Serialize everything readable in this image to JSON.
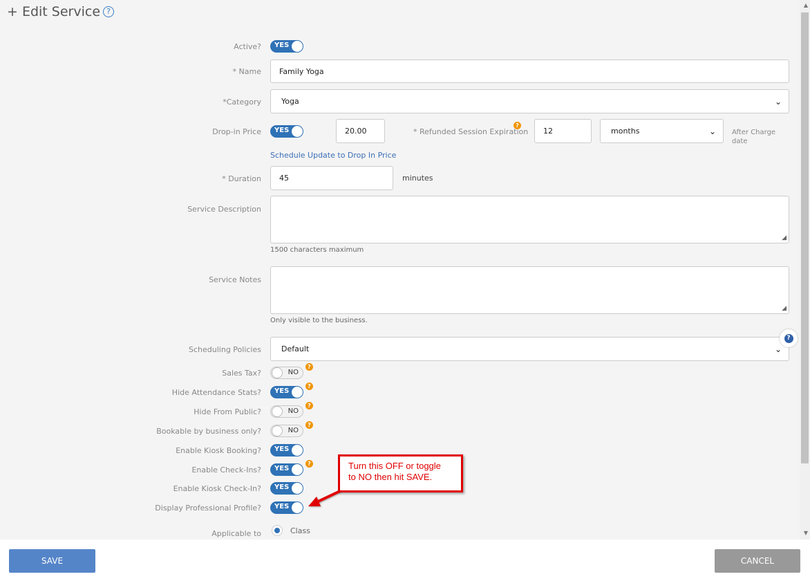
{
  "header": {
    "title": "+ Edit Service",
    "help_glyph": "?"
  },
  "form": {
    "active": {
      "label": "Active?",
      "state": "YES"
    },
    "name": {
      "label": "* Name",
      "value": "Family Yoga"
    },
    "category": {
      "label": "*Category",
      "value": "Yoga"
    },
    "dropin": {
      "label": "Drop-in Price",
      "state": "YES",
      "price": "20.00",
      "refund_label": "* Refunded Session Expiration",
      "refund_value": "12",
      "unit": "months",
      "after_line1": "After Charge",
      "after_line2": "date",
      "schedule_link": "Schedule Update to Drop In Price"
    },
    "duration": {
      "label": "* Duration",
      "value": "45",
      "unit": "minutes"
    },
    "description": {
      "label": "Service Description",
      "hint": "1500 characters maximum"
    },
    "notes": {
      "label": "Service Notes",
      "hint": "Only visible to the business."
    },
    "policies": {
      "label": "Scheduling Policies",
      "value": "Default"
    },
    "toggles": [
      {
        "label": "Sales Tax?",
        "state": "NO"
      },
      {
        "label": "Hide Attendance Stats?",
        "state": "YES"
      },
      {
        "label": "Hide From Public?",
        "state": "NO"
      },
      {
        "label": "Bookable by business only?",
        "state": "NO"
      },
      {
        "label": "Enable Kiosk Booking?",
        "state": "YES"
      },
      {
        "label": "Enable Check-Ins?",
        "state": "YES"
      },
      {
        "label": "Enable Kiosk Check-In?",
        "state": "YES"
      },
      {
        "label": "Display Professional Profile?",
        "state": "YES"
      }
    ],
    "applicable": {
      "label": "Applicable to",
      "option": "Class"
    }
  },
  "annotation": {
    "line1": "Turn this OFF or toggle",
    "line2": "to NO then hit SAVE."
  },
  "footer": {
    "save": "SAVE",
    "cancel": "CANCEL"
  },
  "icons": {
    "question": "?",
    "chevron": "chevron-down-icon",
    "resize": "resize-handle-icon"
  },
  "colors": {
    "toggle_on": "#2f72b6",
    "orange_help": "#f0960a",
    "save_btn": "#5585c9",
    "cancel_btn": "#999999",
    "callout": "#e00000"
  }
}
